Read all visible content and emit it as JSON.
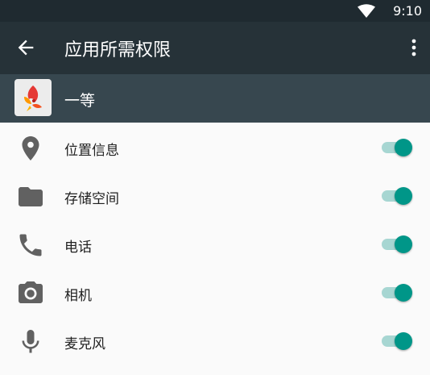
{
  "status_bar": {
    "time": "9:10",
    "wifi_icon": "wifi-icon"
  },
  "toolbar": {
    "title": "应用所需权限",
    "back_icon": "arrow-back-icon",
    "more_icon": "more-vert-icon"
  },
  "app": {
    "name": "一等",
    "icon": "app-icon"
  },
  "permissions": [
    {
      "label": "位置信息",
      "icon": "location-icon",
      "enabled": true
    },
    {
      "label": "存储空间",
      "icon": "folder-icon",
      "enabled": true
    },
    {
      "label": "电话",
      "icon": "phone-icon",
      "enabled": true
    },
    {
      "label": "相机",
      "icon": "camera-icon",
      "enabled": true
    },
    {
      "label": "麦克风",
      "icon": "microphone-icon",
      "enabled": true
    }
  ],
  "colors": {
    "accent": "#009688",
    "toolbar": "#263238",
    "app_row": "#37474f"
  }
}
